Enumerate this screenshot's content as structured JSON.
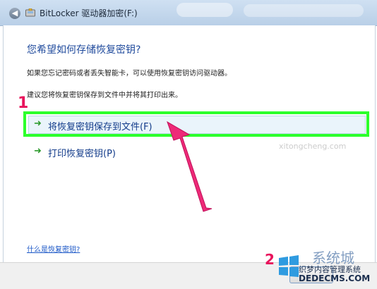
{
  "window": {
    "title": "BitLocker 驱动器加密(F:)"
  },
  "main": {
    "heading": "您希望如何存储恢复密钥?",
    "description1": "如果您忘记密码或者丢失智能卡，可以使用恢复密钥访问驱动器。",
    "description2": "建议您将恢复密钥保存到文件中并将其打印出来。",
    "options": [
      {
        "label": "将恢复密钥保存到文件(F)",
        "icon": "green-arrow-icon"
      },
      {
        "label": "打印恢复密钥(P)",
        "icon": "green-arrow-icon"
      }
    ],
    "help_link": "什么是恢复密钥?"
  },
  "annotations": {
    "step1": "1",
    "step2": "2",
    "accent_color": "#e8145c",
    "highlight_color": "#2cff2c"
  },
  "watermark": {
    "title": "系统城",
    "subtitle": "织梦内容管理系统",
    "url": "DEDECMS.COM",
    "faint_url": "xitongcheng.com"
  }
}
